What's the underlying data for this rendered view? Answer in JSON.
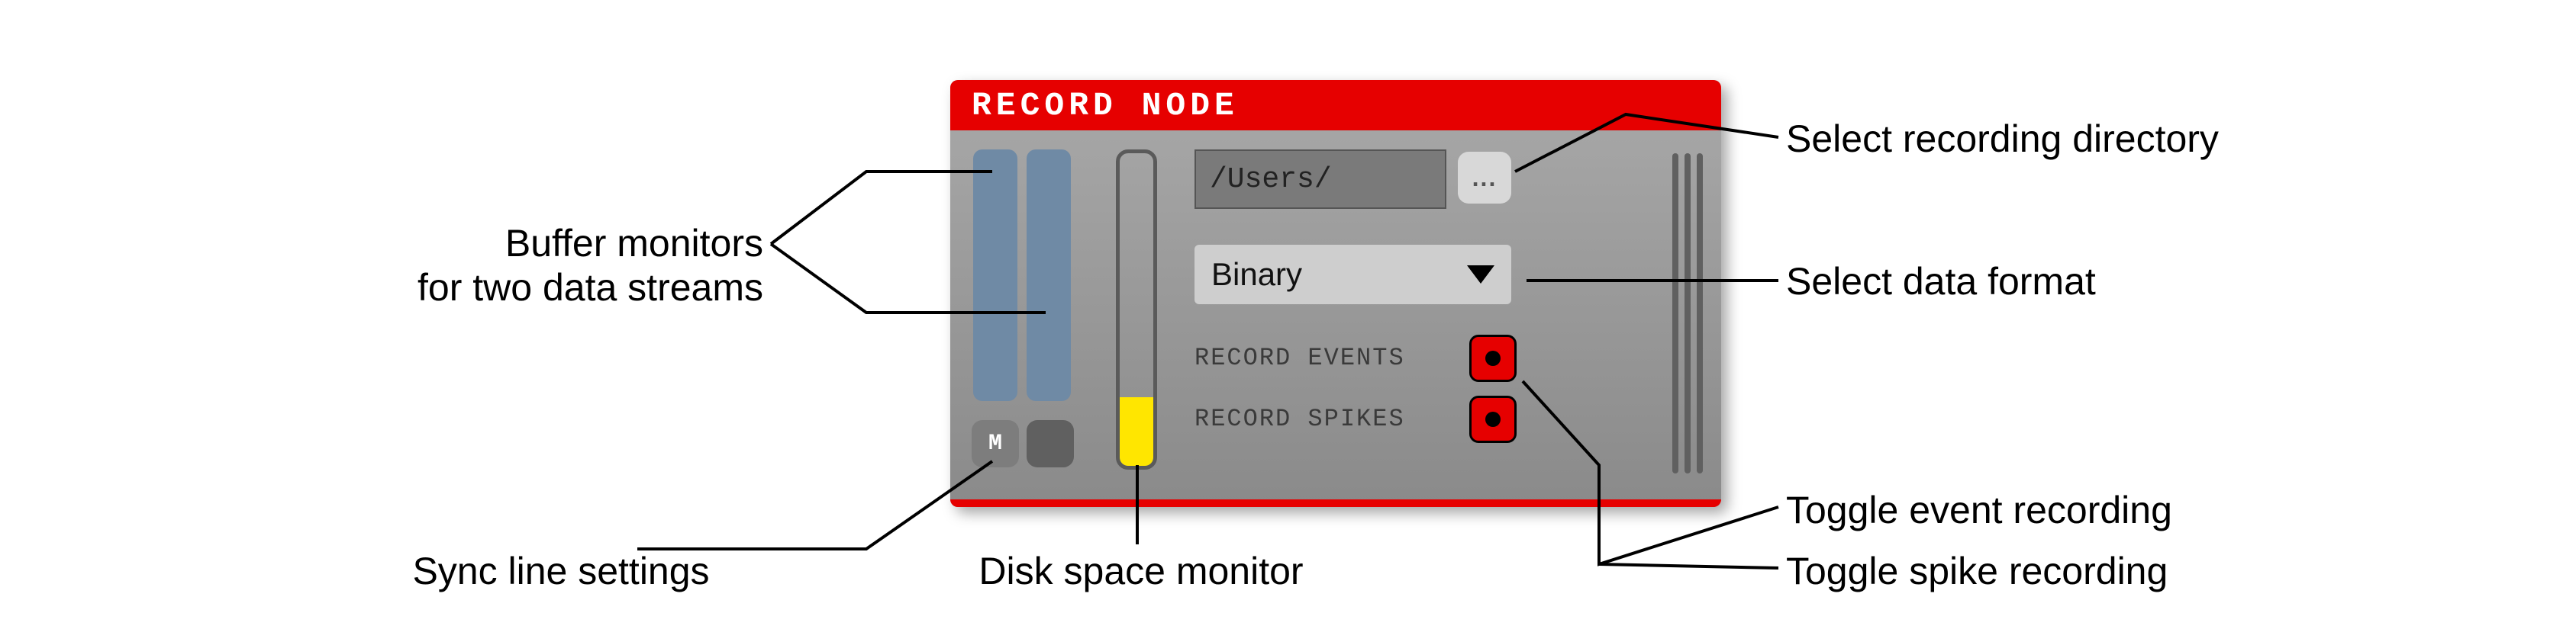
{
  "panel": {
    "title": "RECORD NODE",
    "path_value": "/Users/",
    "browse_label": "...",
    "format_selected": "Binary",
    "sync_m_label": "M",
    "record_events_label": "RECORD EVENTS",
    "record_spikes_label": "RECORD SPIKES"
  },
  "annotations": {
    "buffer_line1": "Buffer monitors",
    "buffer_line2": "for two data streams",
    "sync": "Sync line settings",
    "disk": "Disk space monitor",
    "dir": "Select recording directory",
    "format": "Select data format",
    "events": "Toggle event recording",
    "spikes": "Toggle spike recording"
  }
}
